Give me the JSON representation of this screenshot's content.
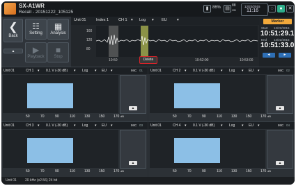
{
  "app": {
    "title": "SX-A1WR",
    "subtitle": "Recall - 20151222_105125"
  },
  "titlebar": {
    "battery": "86%",
    "storage": "88",
    "storage_unit": "GB",
    "date": "12/22/2015",
    "time": "11:16",
    "close_label": "✕"
  },
  "sidebar": {
    "back": "Back",
    "setting": "Setting",
    "analysis": "Analysis",
    "playback": "Playback",
    "stop": "Stop"
  },
  "overview": {
    "unit": "Unit 01",
    "index": "Index 1",
    "ch": "CH 1",
    "scale": "Log",
    "weight": "EU",
    "y_ticks": [
      "160",
      "120",
      "80"
    ],
    "x_ticks": [
      "10:51:00",
      "10:52:00",
      "10:53:00"
    ],
    "short_x": "10:50",
    "delete": "Delete"
  },
  "marker": {
    "title": "Marker",
    "start_label": "Start",
    "start_date": "12/22/2015",
    "start_time": "10:51:29.1",
    "end_label": "End",
    "end_date": "12/22/2015",
    "end_time": "10:51:33.0",
    "prev": "◄",
    "next": "►"
  },
  "units": [
    {
      "unit": "Unit 01",
      "ch": "CH 1",
      "range": "0.1 V (-30 dB)",
      "scale": "Log",
      "weight": "EU",
      "mic": "MIC",
      "micno": "01",
      "x_ticks": [
        "50",
        "70",
        "90",
        "110",
        "130",
        "150",
        "170"
      ],
      "xunit": "dB"
    },
    {
      "unit": "Unit 01",
      "ch": "CH 2",
      "range": "0.1 V (-30 dB)",
      "scale": "Log",
      "weight": "EU",
      "mic": "MIC",
      "micno": "02",
      "x_ticks": [
        "50",
        "70",
        "90",
        "110",
        "130",
        "150",
        "170"
      ],
      "xunit": "dB"
    },
    {
      "unit": "Unit 01",
      "ch": "CH 3",
      "range": "0.1 V (-30 dB)",
      "scale": "Log",
      "weight": "EU",
      "mic": "MIC",
      "micno": "03",
      "x_ticks": [
        "50",
        "70",
        "90",
        "110",
        "130",
        "150",
        "170"
      ],
      "xunit": "dB"
    },
    {
      "unit": "Unit 01",
      "ch": "CH 4",
      "range": "0.1 V (-30 dB)",
      "scale": "Log",
      "weight": "EU",
      "mic": "MIC",
      "micno": "04",
      "x_ticks": [
        "50",
        "70",
        "90",
        "110",
        "130",
        "150",
        "170"
      ],
      "xunit": "dB"
    }
  ],
  "status": {
    "unit": "Unit 01",
    "info": "20 kHz (x2.56) 24 bit"
  }
}
